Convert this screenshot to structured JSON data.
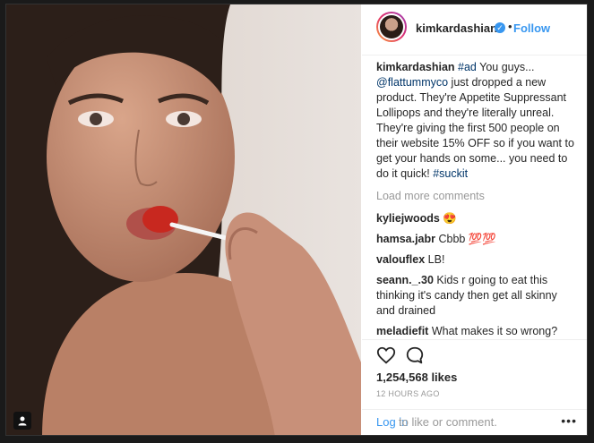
{
  "header": {
    "username": "kimkardashian",
    "separator": "•",
    "follow_label": "Follow"
  },
  "caption": {
    "user": "kimkardashian",
    "hashtag_ad": "#ad",
    "text1": " You guys... ",
    "mention": "@flattummyco",
    "text2": " just dropped a new product. They're Appetite Suppressant Lollipops and they're literally unreal. They're giving the first 500 people on their website 15% OFF so if you want to get your hands on some... you need to do it quick! ",
    "hashtag_suckit": "#suckit"
  },
  "load_more": "Load more comments",
  "comments": [
    {
      "user": "kyliejwoods",
      "text": " 😍"
    },
    {
      "user": "hamsa.jabr",
      "text": " Cbbb 💯💯"
    },
    {
      "user": "valouflex",
      "text": " LB!"
    },
    {
      "user": "seann._.30",
      "text": " Kids r going to eat this thinking it's candy then get all skinny and drained"
    },
    {
      "user": "meladiefit",
      "text": " What makes it so wrong? Because its in the form of a lollipop?? Get over yourselves. There are shakes that do"
    }
  ],
  "likes": "1,254,568 likes",
  "time_ago": "12 HOURS AGO",
  "login_link": "Log in",
  "login_rest": " to like or comment.",
  "more_icon": "•••",
  "colors": {
    "accent": "#3897f0",
    "text": "#262626",
    "muted": "#999999",
    "link": "#003569"
  }
}
